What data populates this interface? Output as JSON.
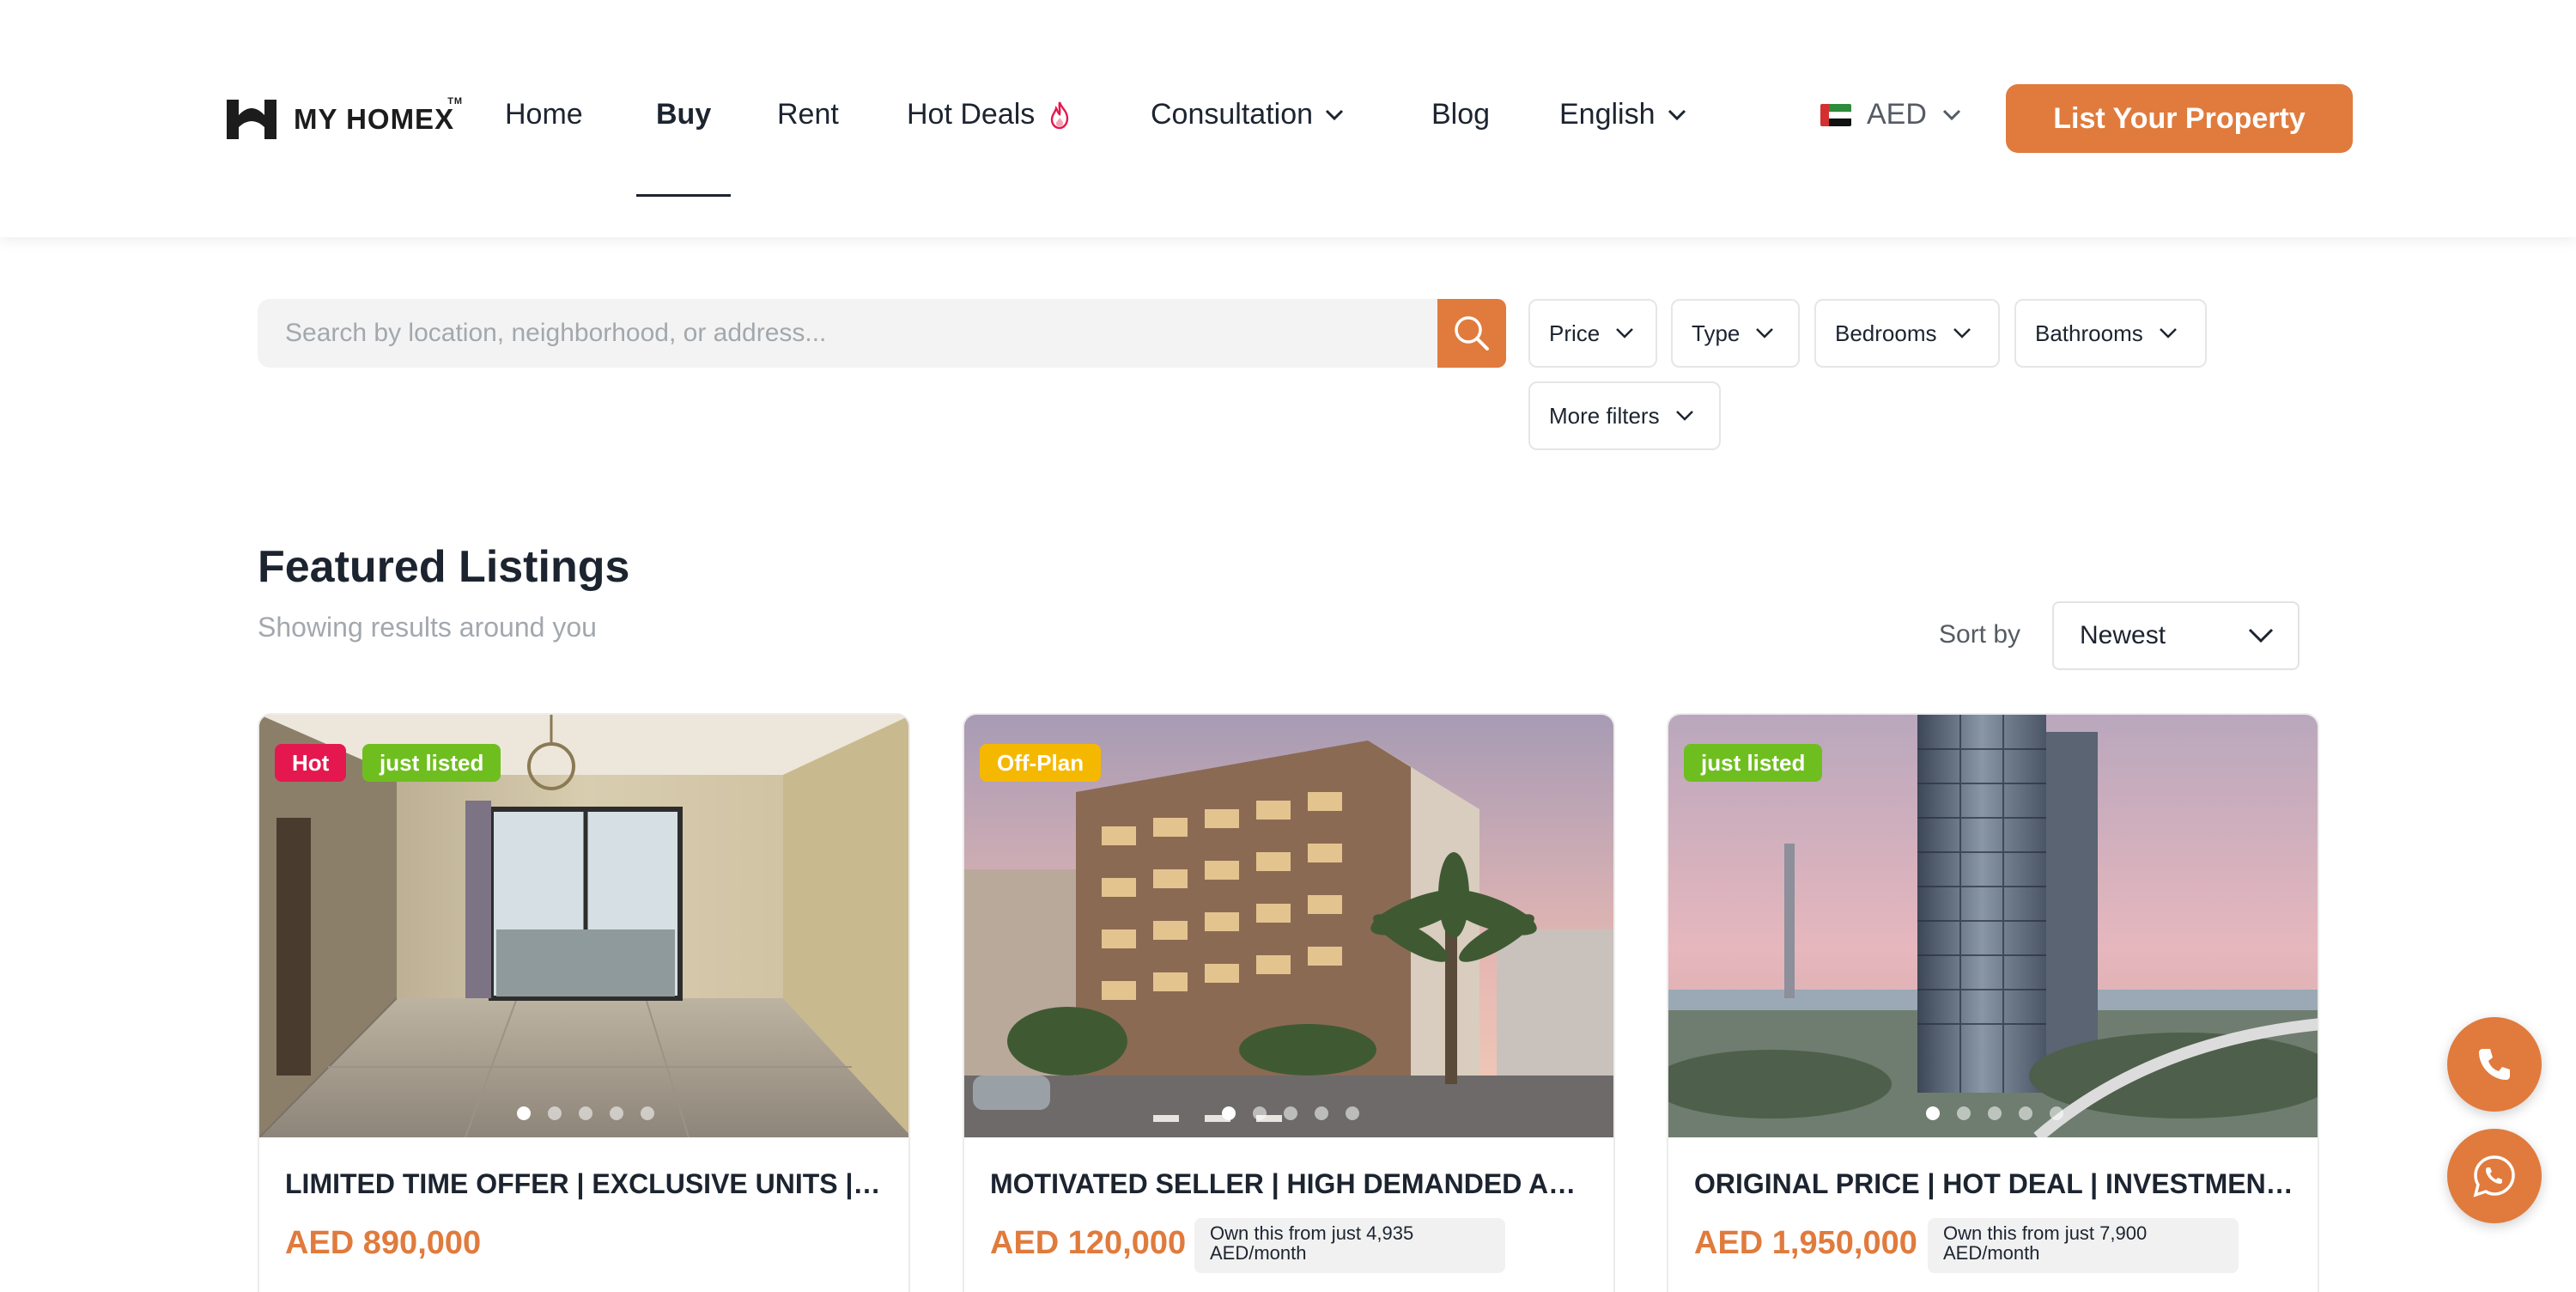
{
  "brand": {
    "name": "MY HOMEX",
    "tm": "TM"
  },
  "nav": {
    "items": [
      {
        "label": "Home"
      },
      {
        "label": "Buy"
      },
      {
        "label": "Rent"
      },
      {
        "label": "Hot Deals"
      },
      {
        "label": "Consultation"
      },
      {
        "label": "Blog"
      },
      {
        "label": "English"
      }
    ],
    "active": "Buy"
  },
  "currency": {
    "code": "AED"
  },
  "header": {
    "list_property_label": "List Your Property"
  },
  "search": {
    "placeholder": "Search by location, neighborhood, or address...",
    "filters": [
      {
        "label": "Price"
      },
      {
        "label": "Type"
      },
      {
        "label": "Bedrooms"
      },
      {
        "label": "Bathrooms"
      },
      {
        "label": "More filters"
      }
    ]
  },
  "listings_section": {
    "title": "Featured Listings",
    "subtitle": "Showing results around you",
    "sort_label": "Sort by",
    "sort_value": "Newest"
  },
  "listings": [
    {
      "badges": [
        {
          "label": "Hot",
          "color": "#e4184f"
        },
        {
          "label": "just listed",
          "color": "#6fbe1f"
        }
      ],
      "title": "LIMITED TIME OFFER | EXCLUSIVE UNITS | AMAZING VIEW",
      "price": "AED 890,000",
      "mortgage": ""
    },
    {
      "badges": [
        {
          "label": "Off-Plan",
          "color": "#f5b800"
        }
      ],
      "title": "MOTIVATED SELLER | HIGH DEMANDED AREA | PAYMENT PLAN",
      "price": "AED 120,000",
      "mortgage": "Own this from just 4,935 AED/month"
    },
    {
      "badges": [
        {
          "label": "just listed",
          "color": "#6fbe1f"
        }
      ],
      "title": "ORIGINAL PRICE | HOT DEAL | INVESTMENT OPPORTUNITY",
      "price": "AED 1,950,000",
      "mortgage": "Own this from just 7,900 AED/month"
    }
  ],
  "colors": {
    "accent": "#e07b3d",
    "text": "#1c2430",
    "muted": "#a3a8ae"
  },
  "icons": {
    "search": "search-icon",
    "chevron": "chevron-down-icon",
    "flame": "flame-icon",
    "phone": "phone-icon",
    "whatsapp": "whatsapp-icon"
  }
}
